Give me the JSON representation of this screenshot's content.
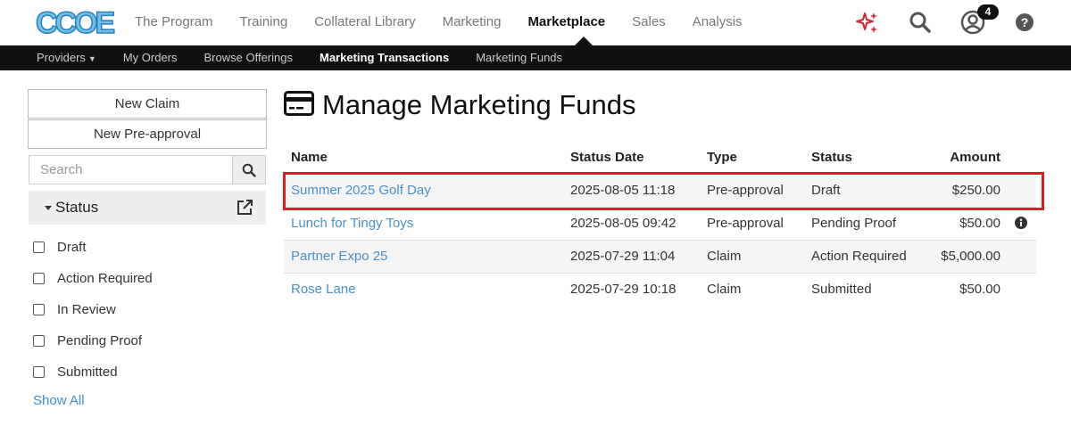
{
  "brand": {
    "logo_text": "CCOE"
  },
  "main_nav": [
    {
      "label": "The Program",
      "active": false
    },
    {
      "label": "Training",
      "active": false
    },
    {
      "label": "Collateral Library",
      "active": false
    },
    {
      "label": "Marketing",
      "active": false
    },
    {
      "label": "Marketplace",
      "active": true
    },
    {
      "label": "Sales",
      "active": false
    },
    {
      "label": "Analysis",
      "active": false
    }
  ],
  "header_icons": {
    "sparkle": "sparkle-icon",
    "search": "search-icon",
    "user": "user-icon",
    "help": "help-icon",
    "notification_count": "4"
  },
  "sub_nav": {
    "providers": "Providers",
    "my_orders": "My Orders",
    "browse_offerings": "Browse Offerings",
    "marketing_transactions": "Marketing Transactions",
    "marketing_funds": "Marketing Funds"
  },
  "sidebar": {
    "new_claim": "New Claim",
    "new_preapproval": "New Pre-approval",
    "search_placeholder": "Search",
    "status_label": "Status",
    "filters": [
      "Draft",
      "Action Required",
      "In Review",
      "Pending Proof",
      "Submitted"
    ],
    "show_all": "Show All"
  },
  "page": {
    "title": "Manage Marketing Funds"
  },
  "table": {
    "headers": {
      "name": "Name",
      "status_date": "Status Date",
      "type": "Type",
      "status": "Status",
      "amount": "Amount"
    },
    "rows": [
      {
        "name": "Summer 2025 Golf Day",
        "status_date": "2025-08-05 11:18",
        "type": "Pre-approval",
        "status": "Draft",
        "amount": "$250.00"
      },
      {
        "name": "Lunch for Tingy Toys",
        "status_date": "2025-08-05 09:42",
        "type": "Pre-approval",
        "status": "Pending Proof",
        "amount": "$50.00"
      },
      {
        "name": "Partner Expo 25",
        "status_date": "2025-07-29 11:04",
        "type": "Claim",
        "status": "Action Required",
        "amount": "$5,000.00"
      },
      {
        "name": "Rose Lane",
        "status_date": "2025-07-29 10:18",
        "type": "Claim",
        "status": "Submitted",
        "amount": "$50.00"
      }
    ]
  },
  "colors": {
    "accent_link": "#4a90c8",
    "highlight": "#e01b24",
    "subnav_bg": "#111111"
  }
}
